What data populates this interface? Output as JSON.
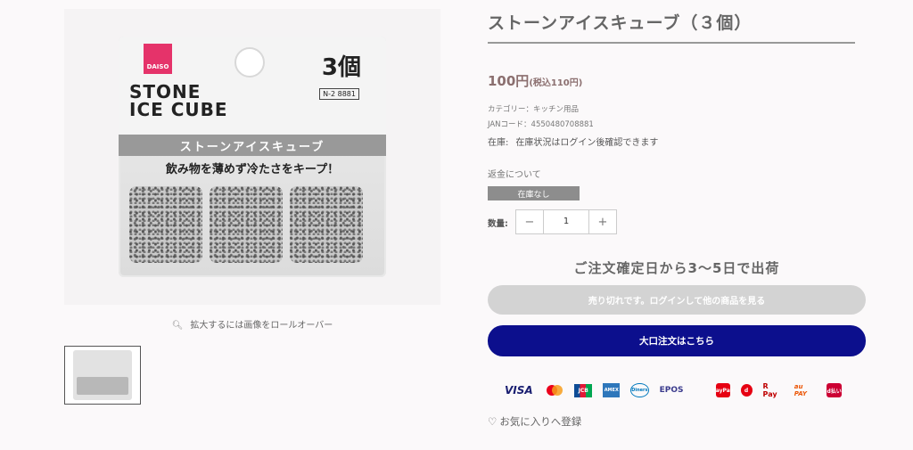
{
  "product": {
    "image": {
      "brand": "DAISO",
      "pkg_title_line1": "STONE",
      "pkg_title_line2": "ICE CUBE",
      "pkg_count": "3個",
      "pkg_code": "N-2 8881",
      "pkg_band": "ストーンアイスキューブ",
      "pkg_sub": "飲み物を薄めず冷たさをキープ！"
    },
    "zoom_hint": "拡大するには画像をロールオーバー",
    "title": "ストーンアイスキューブ（３個）",
    "price": "100円",
    "price_tax": "(税込110円)",
    "category": "カテゴリー：キッチン用品",
    "jan": "JANコード：4550480708881",
    "stock_label": "在庫:",
    "stock_text": "在庫状況はログイン後確認できます",
    "refund": "返金について",
    "badge": "在庫なし",
    "qty_label": "数量:",
    "qty_minus": "−",
    "qty_value": "1",
    "qty_plus": "+",
    "delivery": "ご注文確定日から3〜5日で出荷",
    "soldout_button": "売り切れです。ログインして他の商品を見る",
    "bulk_button": "大口注文はこちら",
    "favorite": "お気に入りへ登録"
  },
  "payments": [
    {
      "name": "visa-icon",
      "label": "VISA"
    },
    {
      "name": "mastercard-icon",
      "label": ""
    },
    {
      "name": "jcb-icon",
      "label": "JCB"
    },
    {
      "name": "amex-icon",
      "label": "AMEX"
    },
    {
      "name": "diners-icon",
      "label": "Diners"
    },
    {
      "name": "epos-icon",
      "label": "EPOS"
    },
    {
      "name": "paypay-icon",
      "label": "PayPay"
    },
    {
      "name": "dpay-icon",
      "label": "d"
    },
    {
      "name": "rpay-icon",
      "label": "R Pay"
    },
    {
      "name": "aupay-icon",
      "label": "au PAY"
    },
    {
      "name": "dbarai-icon",
      "label": "d払い"
    }
  ],
  "colors": {
    "accent": "#0c0f8d",
    "price": "#8b6f6f",
    "badge": "#8d8d8d",
    "disabled_button": "#d3d3d3"
  }
}
